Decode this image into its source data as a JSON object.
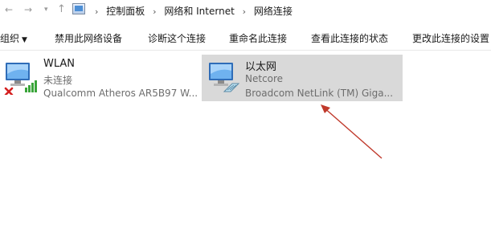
{
  "address_bar": {
    "breadcrumbs": [
      "控制面板",
      "网络和 Internet",
      "网络连接"
    ]
  },
  "toolbar": {
    "organize_label": "组织",
    "disable_label": "禁用此网络设备",
    "diagnose_label": "诊断这个连接",
    "rename_label": "重命名此连接",
    "status_label": "查看此连接的状态",
    "change_settings_label": "更改此连接的设置"
  },
  "adapters": [
    {
      "name": "WLAN",
      "status": "未连接",
      "device": "Qualcomm Atheros AR5B97 W...",
      "icon": "wireless-adapter-icon",
      "disconnected": true
    },
    {
      "name": "以太网",
      "status": "Netcore",
      "device": "Broadcom NetLink (TM) Giga...",
      "icon": "ethernet-adapter-icon",
      "selected": true
    }
  ],
  "colors": {
    "selection": "#d9d9d9",
    "annotation_arrow": "#c0392b",
    "signal_bars": "#3aa53a"
  }
}
